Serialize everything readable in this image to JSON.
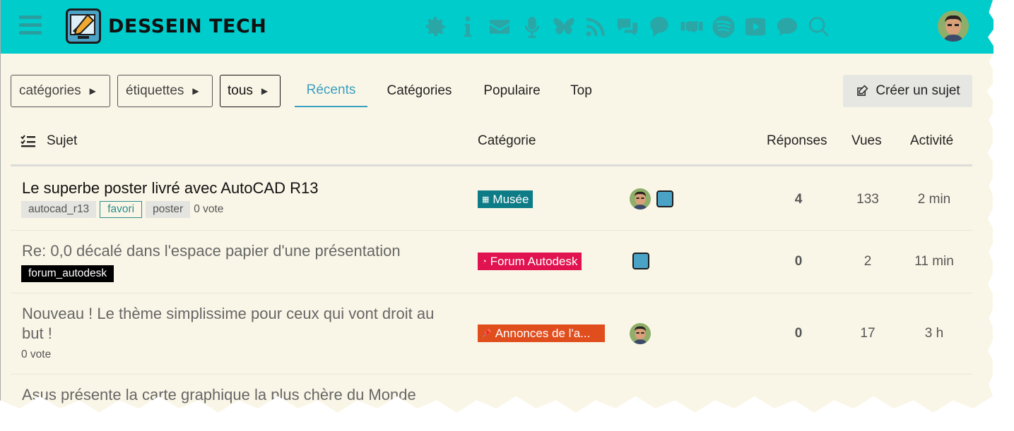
{
  "header": {
    "site_name": "DESSEIN TECH",
    "icons": [
      "gear-icon",
      "info-icon",
      "mail-icon",
      "microphone-icon",
      "butterfly-icon",
      "rss-icon",
      "chat-bubbles-icon",
      "speech-bubble-icon",
      "handshake-icon",
      "spotify-icon",
      "youtube-icon",
      "comment-icon",
      "search-icon"
    ]
  },
  "nav": {
    "categories_dd": "catégories",
    "tags_dd": "étiquettes",
    "all_dd": "tous",
    "tabs": [
      "Récents",
      "Catégories",
      "Populaire",
      "Top"
    ],
    "active_tab": "Récents",
    "create_label": "Créer un sujet"
  },
  "columns": {
    "topic": "Sujet",
    "category": "Catégorie",
    "replies": "Réponses",
    "views": "Vues",
    "activity": "Activité"
  },
  "topics": [
    {
      "title": "Le superbe poster livré avec AutoCAD R13",
      "tags": [
        "autocad_r13",
        "favori",
        "poster"
      ],
      "votes": "0 vote",
      "category": "Musée",
      "category_color": "#0e7c86",
      "replies": "4",
      "views": "133",
      "activity": "2 min"
    },
    {
      "title": "Re: 0,0 décalé dans l'espace papier d'une présentation",
      "tags": [
        "forum_autodesk"
      ],
      "category": "Forum Autodesk",
      "category_color": "#e0124f",
      "replies": "0",
      "views": "2",
      "activity": "11 min"
    },
    {
      "title_line1": "Nouveau ! Le thème simplissime pour ceux qui vont droit au",
      "title_line2": "but !",
      "votes": "0 vote",
      "category": "Annonces de l'a...",
      "category_color": "#e04e1e",
      "replies": "0",
      "views": "17",
      "activity": "3 h"
    },
    {
      "title": "Asus présente la carte graphique la plus chère du Monde"
    }
  ]
}
